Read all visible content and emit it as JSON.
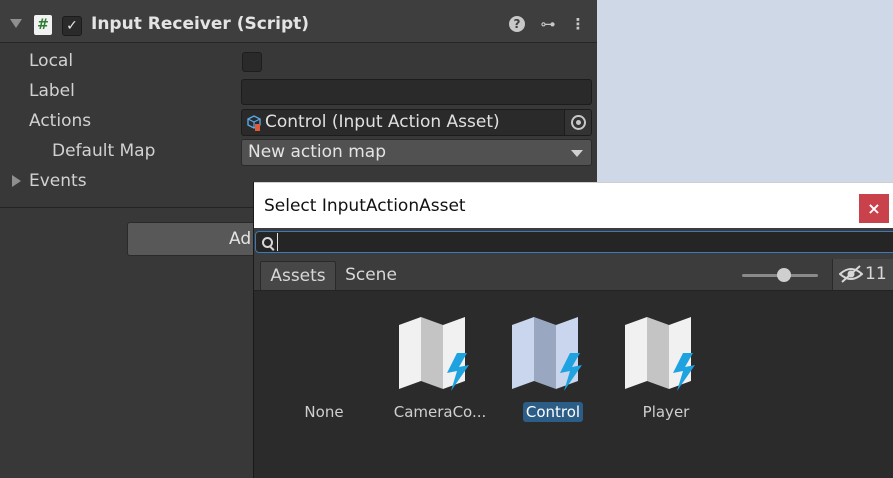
{
  "component": {
    "title": "Input Receiver (Script)",
    "script_icon_glyph": "#",
    "enabled_glyph": "✓",
    "icons": [
      "help-icon",
      "preset-icon",
      "context-menu-icon"
    ],
    "help_glyph": "?",
    "preset_glyph": "⊶",
    "menu_glyph": "⋮"
  },
  "properties": {
    "local_label": "Local",
    "local_checked": false,
    "label_label": "Label",
    "label_value": "",
    "actions_label": "Actions",
    "actions_value": "Control (Input Action Asset)",
    "default_map_label": "Default Map",
    "default_map_value": "New action map",
    "events_label": "Events"
  },
  "add_button": {
    "label": "Ad"
  },
  "picker": {
    "title": "Select InputActionAsset",
    "close_glyph": "×",
    "search": {
      "value": "",
      "placeholder": ""
    },
    "tabs": [
      {
        "label": "Assets",
        "active": true
      },
      {
        "label": "Scene",
        "active": false
      }
    ],
    "zoom_fraction": 0.55,
    "hidden_count": "11",
    "items": [
      {
        "label": "None",
        "icon": "none",
        "selected": false
      },
      {
        "label": "CameraCo...",
        "icon": "input-action-asset-icon",
        "selected": false
      },
      {
        "label": "Control",
        "icon": "input-action-asset-icon",
        "selected": true
      },
      {
        "label": "Player",
        "icon": "input-action-asset-icon",
        "selected": false
      }
    ]
  },
  "colors": {
    "inspector_bg": "#383838",
    "picker_bg": "#2b2b2b",
    "selection": "#2c5d87",
    "close_button": "#c8414b",
    "search_focus": "#3a79bb",
    "lightning": "#1fa3e0"
  }
}
